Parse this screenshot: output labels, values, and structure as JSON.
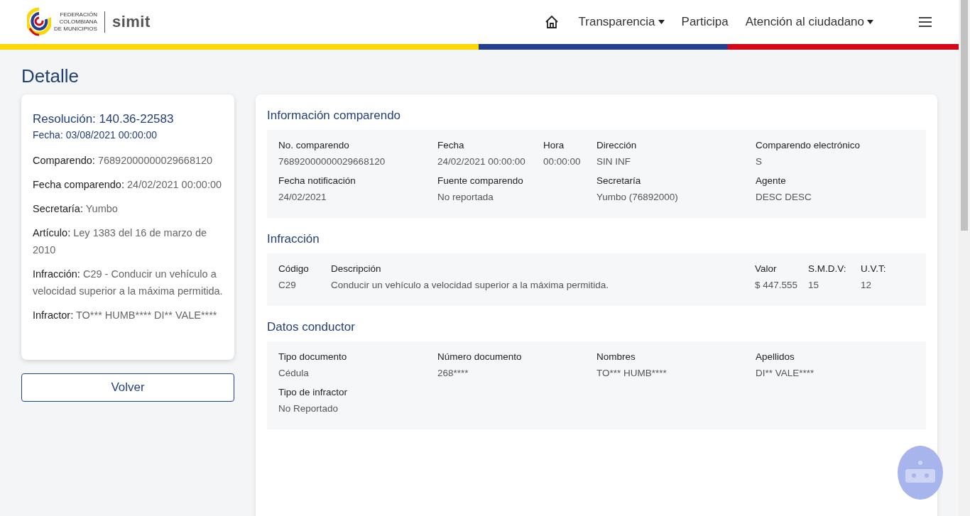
{
  "header": {
    "logo_lines": [
      "FEDERACIÓN",
      "COLOMBIANA",
      "DE MUNICIPIOS"
    ],
    "brand": "simit",
    "nav": [
      {
        "label": "Transparencia",
        "dropdown": true
      },
      {
        "label": "Participa",
        "dropdown": false
      },
      {
        "label": "Atención al ciudadano",
        "dropdown": true
      }
    ]
  },
  "page_title": "Detalle",
  "summary": {
    "title": "Resolución: 140.36-22583",
    "date": "Fecha: 03/08/2021 00:00:00",
    "lines": [
      {
        "label": "Comparendo:",
        "value": "76892000000029668120"
      },
      {
        "label": "Fecha comparendo:",
        "value": "24/02/2021 00:00:00"
      },
      {
        "label": "Secretaría:",
        "value": "Yumbo"
      },
      {
        "label": "Artículo:",
        "value": "Ley 1383 del 16 de marzo de 2010"
      },
      {
        "label": "Infracción:",
        "value": "C29 - Conducir un vehículo a velocidad superior a la máxima permitida."
      },
      {
        "label": "Infractor:",
        "value": "TO*** HUMB**** DI** VALE****"
      }
    ]
  },
  "back_button": "Volver",
  "sections": [
    {
      "title": "Información comparendo",
      "kind": "fields",
      "rows": [
        [
          {
            "label": "No. comparendo",
            "value": "76892000000029668120"
          },
          {
            "label": "Fecha",
            "value": "24/02/2021 00:00:00"
          },
          {
            "label": "Hora",
            "value": "00:00:00"
          },
          {
            "label": "Dirección",
            "value": "SIN INF"
          },
          {
            "label": "Comparendo electrónico",
            "value": "S"
          }
        ],
        [
          {
            "label": "Fecha notificación",
            "value": "24/02/2021"
          },
          {
            "label": "Fuente comparendo",
            "value": "No reportada"
          },
          null,
          {
            "label": "Secretaría",
            "value": "Yumbo (76892000)"
          },
          {
            "label": "Agente",
            "value": "DESC DESC"
          }
        ]
      ]
    },
    {
      "title": "Infracción",
      "kind": "table",
      "rows": [
        [
          {
            "label": "Código",
            "value": "C29"
          },
          {
            "label": "Descripción",
            "value": "Conducir un vehículo a velocidad superior a la máxima permitida."
          },
          {
            "label": "Valor",
            "value": "$ 447.555"
          },
          {
            "label": "S.M.D.V:",
            "value": "15"
          },
          {
            "label": "U.V.T:",
            "value": "12"
          }
        ]
      ]
    },
    {
      "title": "Datos conductor",
      "kind": "fields",
      "rows": [
        [
          {
            "label": "Tipo documento",
            "value": "Cédula"
          },
          {
            "label": "Número documento",
            "value": "268****"
          },
          {
            "label": "Nombres",
            "value": "TO*** HUMB****"
          },
          {
            "label": "Apellidos",
            "value": "DI** VALE****"
          }
        ],
        [
          {
            "label": "Tipo de infractor",
            "value": "No Reportado"
          }
        ]
      ]
    }
  ]
}
